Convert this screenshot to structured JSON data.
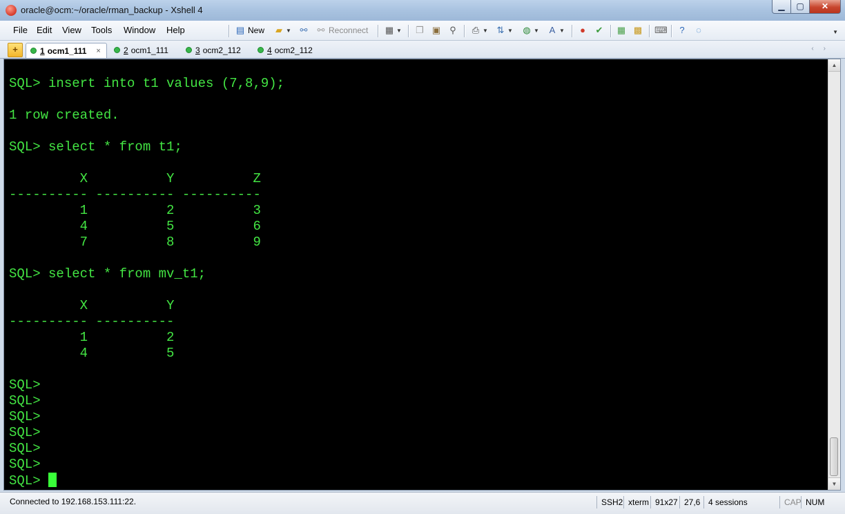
{
  "window": {
    "title": "oracle@ocm:~/oracle/rman_backup - Xshell 4",
    "minimize": "▁",
    "maximize": "▢",
    "close": "✕"
  },
  "menu": [
    "File",
    "Edit",
    "View",
    "Tools",
    "Window",
    "Help"
  ],
  "toolbar": {
    "new_label": "New",
    "reconnect_label": "Reconnect"
  },
  "tabs": [
    {
      "num": "1",
      "label": "ocm1_111",
      "active": true
    },
    {
      "num": "2",
      "label": "ocm1_111",
      "active": false
    },
    {
      "num": "3",
      "label": "ocm2_112",
      "active": false
    },
    {
      "num": "4",
      "label": "ocm2_112",
      "active": false
    }
  ],
  "terminal": {
    "lines": [
      "SQL> insert into t1 values (7,8,9);",
      "",
      "1 row created.",
      "",
      "SQL> select * from t1;",
      "",
      "         X          Y          Z",
      "---------- ---------- ----------",
      "         1          2          3",
      "         4          5          6",
      "         7          8          9",
      "",
      "SQL> select * from mv_t1;",
      "",
      "         X          Y",
      "---------- ----------",
      "         1          2",
      "         4          5",
      "",
      "SQL>",
      "SQL>",
      "SQL>",
      "SQL>",
      "SQL>",
      "SQL>"
    ],
    "prompt": "SQL> ",
    "text_color": "#43e543",
    "background": "#000000"
  },
  "status": {
    "connection": "Connected to 192.168.153.111:22.",
    "protocol": "SSH2",
    "term": "xterm",
    "size": "91x27",
    "cursor_pos": "27,6",
    "sessions": "4 sessions",
    "caps": "CAP",
    "num": "NUM"
  }
}
